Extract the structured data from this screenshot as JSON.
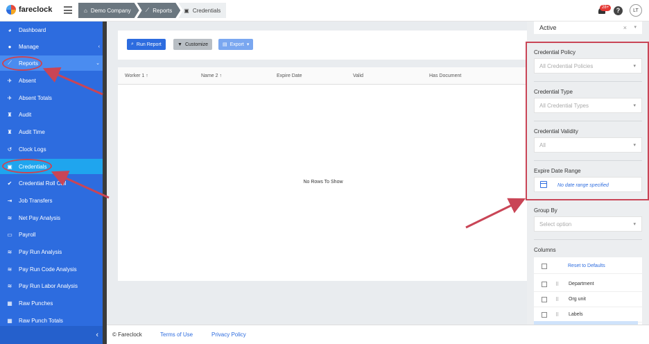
{
  "app": {
    "brand": "fareclock"
  },
  "breadcrumbs": [
    "Demo Company",
    "Reports",
    "Credentials"
  ],
  "topbar": {
    "notification_count": "28+",
    "help_glyph": "?",
    "avatar_initials": "LT"
  },
  "sidebar": {
    "items": [
      {
        "label": "Dashboard",
        "icon": "dashboard-icon"
      },
      {
        "label": "Manage",
        "icon": "person-icon",
        "chevron": "‹"
      },
      {
        "label": "Reports",
        "icon": "chart-icon",
        "chevron": "⌄"
      },
      {
        "label": "Absent",
        "icon": "plane-icon"
      },
      {
        "label": "Absent Totals",
        "icon": "plane-icon"
      },
      {
        "label": "Audit",
        "icon": "audit-icon"
      },
      {
        "label": "Audit Time",
        "icon": "audit-icon"
      },
      {
        "label": "Clock Logs",
        "icon": "history-icon"
      },
      {
        "label": "Credentials",
        "icon": "credential-icon"
      },
      {
        "label": "Credential Roll Call",
        "icon": "check-circle-icon"
      },
      {
        "label": "Job Transfers",
        "icon": "transfer-icon"
      },
      {
        "label": "Net Pay Analysis",
        "icon": "analysis-icon"
      },
      {
        "label": "Payroll",
        "icon": "money-icon"
      },
      {
        "label": "Pay Run Analysis",
        "icon": "analysis-icon"
      },
      {
        "label": "Pay Run Code Analysis",
        "icon": "analysis-icon"
      },
      {
        "label": "Pay Run Labor Analysis",
        "icon": "analysis-icon"
      },
      {
        "label": "Raw Punches",
        "icon": "table-icon"
      },
      {
        "label": "Raw Punch Totals",
        "icon": "table-icon"
      }
    ],
    "collapse_glyph": "‹"
  },
  "toolbar": {
    "run": "Run Report",
    "customize": "Customize",
    "export": "Export"
  },
  "grid": {
    "columns": [
      {
        "label": "Worker",
        "sort": "1 ↑"
      },
      {
        "label": "Name",
        "sort": "2 ↑"
      },
      {
        "label": "Expire Date",
        "sort": ""
      },
      {
        "label": "Valid",
        "sort": ""
      },
      {
        "label": "Has Document",
        "sort": ""
      }
    ],
    "empty": "No Rows To Show"
  },
  "filters": {
    "status": {
      "value": "Active",
      "clear": "×"
    },
    "credential_policy": {
      "label": "Credential Policy",
      "placeholder": "All Credential Policies"
    },
    "credential_type": {
      "label": "Credential Type",
      "placeholder": "All Credential Types"
    },
    "credential_validity": {
      "label": "Credential Validity",
      "placeholder": "All"
    },
    "expire_date_range": {
      "label": "Expire Date Range",
      "placeholder": "No date range specified"
    },
    "group_by": {
      "label": "Group By",
      "placeholder": "Select option"
    },
    "columns": {
      "label": "Columns",
      "reset": "Reset to Defaults",
      "items": [
        "Department",
        "Org unit",
        "Labels"
      ]
    }
  },
  "footer": {
    "copyright": "© Fareclock",
    "terms": "Terms of Use",
    "privacy": "Privacy Policy"
  },
  "colors": {
    "brand_blue": "#2d6cdf",
    "sidebar_selected": "#1fa5ee",
    "annotation_red": "#c94556"
  }
}
